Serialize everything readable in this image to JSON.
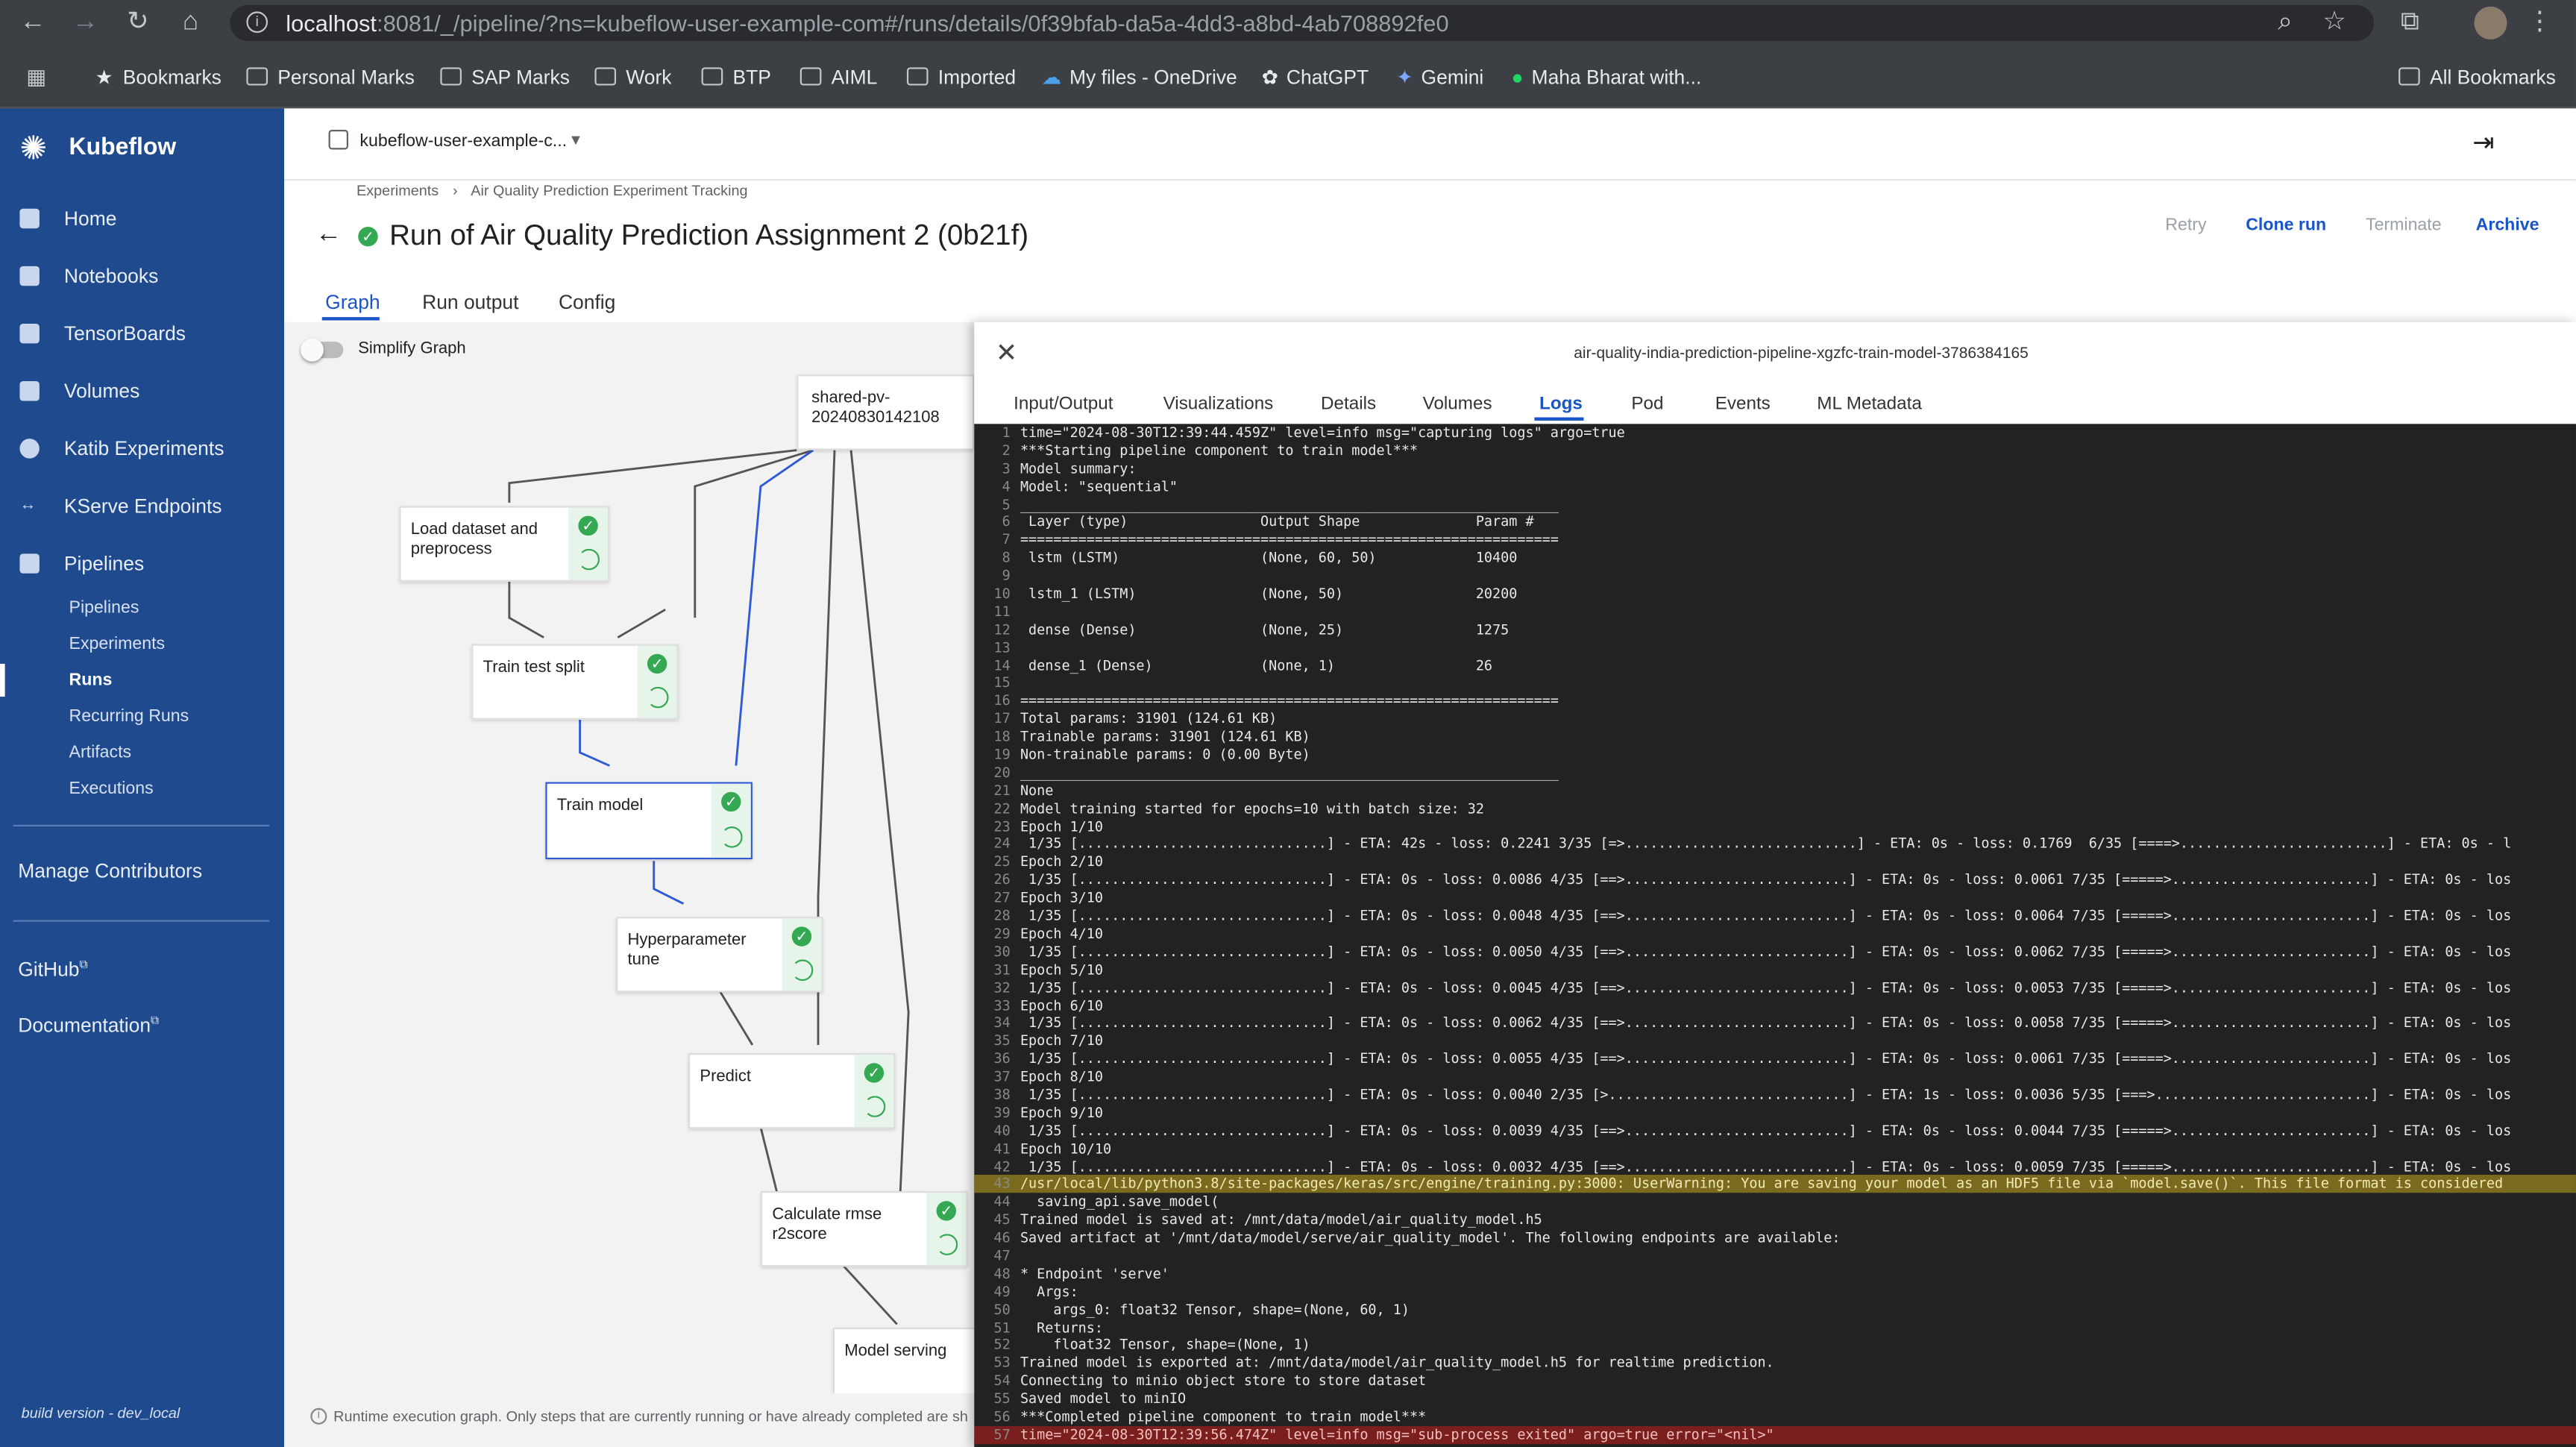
{
  "browser": {
    "url_host": "localhost",
    "url_rest": ":8081/_/pipeline/?ns=kubeflow-user-example-com#/runs/details/0f39bfab-da5a-4dd3-a8bd-4ab708892fe0",
    "bookmarks": [
      "Bookmarks",
      "Personal Marks",
      "SAP Marks",
      "Work",
      "BTP",
      "AIML",
      "Imported",
      "My files - OneDrive",
      "ChatGPT",
      "Gemini",
      "Maha Bharat with..."
    ],
    "all_bookmarks": "All Bookmarks"
  },
  "sidebar": {
    "brand": "Kubeflow",
    "items": [
      "Home",
      "Notebooks",
      "TensorBoards",
      "Volumes",
      "Katib Experiments",
      "KServe Endpoints",
      "Pipelines"
    ],
    "sub_items": [
      "Pipelines",
      "Experiments",
      "Runs",
      "Recurring Runs",
      "Artifacts",
      "Executions"
    ],
    "manage": "Manage Contributors",
    "github": "GitHub",
    "docs": "Documentation",
    "build": "build version - dev_local"
  },
  "header": {
    "namespace": "kubeflow-user-example-c...",
    "breadcrumb_root": "Experiments",
    "breadcrumb_sep": "›",
    "breadcrumb_leaf": "Air Quality Prediction Experiment Tracking",
    "title": "Run of Air Quality Prediction Assignment 2 (0b21f)",
    "actions": {
      "retry": "Retry",
      "clone": "Clone run",
      "terminate": "Terminate",
      "archive": "Archive"
    },
    "tabs": [
      "Graph",
      "Run output",
      "Config"
    ]
  },
  "graph": {
    "simplify": "Simplify Graph",
    "nodes": [
      "shared-pv-20240830142108",
      "Load dataset and preprocess",
      "Train test split",
      "Train model",
      "Hyperparameter tune",
      "Predict",
      "Calculate rmse r2score",
      "Model serving"
    ],
    "footer": "Runtime execution graph. Only steps that are currently running or have already completed are sh"
  },
  "panel": {
    "title": "air-quality-india-prediction-pipeline-xgzfc-train-model-3786384165",
    "tabs": [
      "Input/Output",
      "Visualizations",
      "Details",
      "Volumes",
      "Logs",
      "Pod",
      "Events",
      "ML Metadata"
    ],
    "active_tab": "Logs",
    "log_lines": [
      "time=\"2024-08-30T12:39:44.459Z\" level=info msg=\"capturing logs\" argo=true",
      "***Starting pipeline component to train model***",
      "Model summary:",
      "Model: \"sequential\"",
      "_________________________________________________________________",
      " Layer (type)                Output Shape              Param #   ",
      "=================================================================",
      " lstm (LSTM)                 (None, 60, 50)            10400     ",
      "",
      " lstm_1 (LSTM)               (None, 50)                20200     ",
      "",
      " dense (Dense)               (None, 25)                1275      ",
      "",
      " dense_1 (Dense)             (None, 1)                 26        ",
      "",
      "=================================================================",
      "Total params: 31901 (124.61 KB)",
      "Trainable params: 31901 (124.61 KB)",
      "Non-trainable params: 0 (0.00 Byte)",
      "_________________________________________________________________",
      "None",
      "Model training started for epochs=10 with batch size: 32",
      "Epoch 1/10",
      " 1/35 [..............................] - ETA: 42s - loss: 0.2241 3/35 [=>............................] - ETA: 0s - loss: 0.1769  6/35 [====>.........................] - ETA: 0s - l",
      "Epoch 2/10",
      " 1/35 [..............................] - ETA: 0s - loss: 0.0086 4/35 [==>...........................] - ETA: 0s - loss: 0.0061 7/35 [=====>........................] - ETA: 0s - los",
      "Epoch 3/10",
      " 1/35 [..............................] - ETA: 0s - loss: 0.0048 4/35 [==>...........................] - ETA: 0s - loss: 0.0064 7/35 [=====>........................] - ETA: 0s - los",
      "Epoch 4/10",
      " 1/35 [..............................] - ETA: 0s - loss: 0.0050 4/35 [==>...........................] - ETA: 0s - loss: 0.0062 7/35 [=====>........................] - ETA: 0s - los",
      "Epoch 5/10",
      " 1/35 [..............................] - ETA: 0s - loss: 0.0045 4/35 [==>...........................] - ETA: 0s - loss: 0.0053 7/35 [=====>........................] - ETA: 0s - los",
      "Epoch 6/10",
      " 1/35 [..............................] - ETA: 0s - loss: 0.0062 4/35 [==>...........................] - ETA: 0s - loss: 0.0058 7/35 [=====>........................] - ETA: 0s - los",
      "Epoch 7/10",
      " 1/35 [..............................] - ETA: 0s - loss: 0.0055 4/35 [==>...........................] - ETA: 0s - loss: 0.0061 7/35 [=====>........................] - ETA: 0s - los",
      "Epoch 8/10",
      " 1/35 [..............................] - ETA: 0s - loss: 0.0040 2/35 [>.............................] - ETA: 1s - loss: 0.0036 5/35 [===>..........................] - ETA: 0s - los",
      "Epoch 9/10",
      " 1/35 [..............................] - ETA: 0s - loss: 0.0039 4/35 [==>...........................] - ETA: 0s - loss: 0.0044 7/35 [=====>........................] - ETA: 0s - los",
      "Epoch 10/10",
      " 1/35 [..............................] - ETA: 0s - loss: 0.0032 4/35 [==>...........................] - ETA: 0s - loss: 0.0059 7/35 [=====>........................] - ETA: 0s - los",
      "/usr/local/lib/python3.8/site-packages/keras/src/engine/training.py:3000: UserWarning: You are saving your model as an HDF5 file via `model.save()`. This file format is considered",
      "  saving_api.save_model(",
      "Trained model is saved at: /mnt/data/model/air_quality_model.h5",
      "Saved artifact at '/mnt/data/model/serve/air_quality_model'. The following endpoints are available:",
      "",
      "* Endpoint 'serve'",
      "  Args:",
      "    args_0: float32 Tensor, shape=(None, 60, 1)",
      "  Returns:",
      "    float32 Tensor, shape=(None, 1)",
      "Trained model is exported at: /mnt/data/model/air_quality_model.h5 for realtime prediction.",
      "Connecting to minio object store to store dataset",
      "Saved model to minIO",
      "***Completed pipeline component to train model***",
      "time=\"2024-08-30T12:39:56.474Z\" level=info msg=\"sub-process exited\" argo=true error=\"<nil>\""
    ],
    "warn_line": 43,
    "err_line": 57
  },
  "colors": {
    "sidebar": "#1f4b8e",
    "accent": "#1a73e8",
    "success": "#34a853",
    "log_bg": "#222222"
  }
}
